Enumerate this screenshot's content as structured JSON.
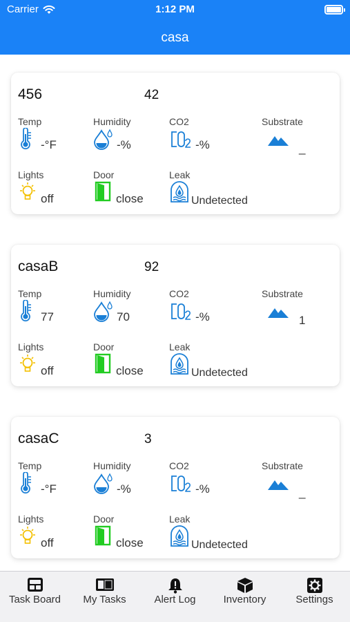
{
  "status_bar": {
    "carrier": "Carrier",
    "time": "1:12 PM"
  },
  "nav": {
    "title": "casa"
  },
  "labels": {
    "temp": "Temp",
    "humidity": "Humidity",
    "co2": "CO2",
    "substrate": "Substrate",
    "lights": "Lights",
    "door": "Door",
    "leak": "Leak"
  },
  "colors": {
    "brand_blue": "#1a82f7",
    "icon_blue": "#1a7fd6",
    "light_yellow": "#f3c000",
    "door_green": "#22cc22"
  },
  "cards": [
    {
      "name": "456",
      "count": "42",
      "temp": "-°F",
      "humidity": "-%",
      "co2": "-%",
      "substrate": "_",
      "lights": "off",
      "door": "close",
      "leak": "Undetected"
    },
    {
      "name": "casaB",
      "count": "92",
      "temp": "77",
      "humidity": "70",
      "co2": "-%",
      "substrate": "1",
      "lights": "off",
      "door": "close",
      "leak": "Undetected"
    },
    {
      "name": "casaC",
      "count": "3",
      "temp": "-°F",
      "humidity": "-%",
      "co2": "-%",
      "substrate": "_",
      "lights": "off",
      "door": "close",
      "leak": "Undetected"
    }
  ],
  "tabs": [
    {
      "label": "Task Board",
      "icon": "task-board-icon"
    },
    {
      "label": "My Tasks",
      "icon": "my-tasks-icon"
    },
    {
      "label": "Alert Log",
      "icon": "bell-icon"
    },
    {
      "label": "Inventory",
      "icon": "box-icon"
    },
    {
      "label": "Settings",
      "icon": "gear-icon"
    }
  ]
}
